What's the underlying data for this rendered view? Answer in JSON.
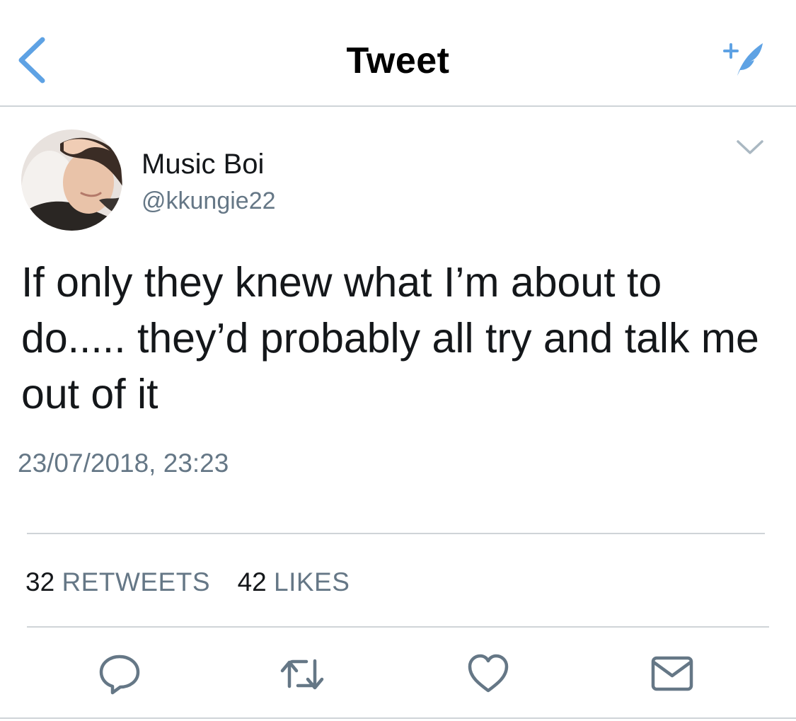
{
  "navbar": {
    "title": "Tweet",
    "back_icon": "chevron-left-icon",
    "compose_icon": "compose-feather-icon"
  },
  "tweet": {
    "author": {
      "display_name": "Music Boi",
      "handle": "@kkungie22"
    },
    "text": "If only they knew what I’m about to do..... they’d probably all try and talk me out of it",
    "timestamp": "23/07/2018, 23:23",
    "stats": {
      "retweets_count": "32",
      "retweets_label": "RETWEETS",
      "likes_count": "42",
      "likes_label": "LIKES"
    },
    "actions": [
      "reply-icon",
      "retweet-icon",
      "heart-icon",
      "envelope-icon"
    ]
  },
  "colors": {
    "accent": "#1da1f2",
    "nav_icon": "#5ea2e4",
    "text_primary": "#14171a",
    "text_secondary": "#657786",
    "divider": "#cfd4d8"
  }
}
